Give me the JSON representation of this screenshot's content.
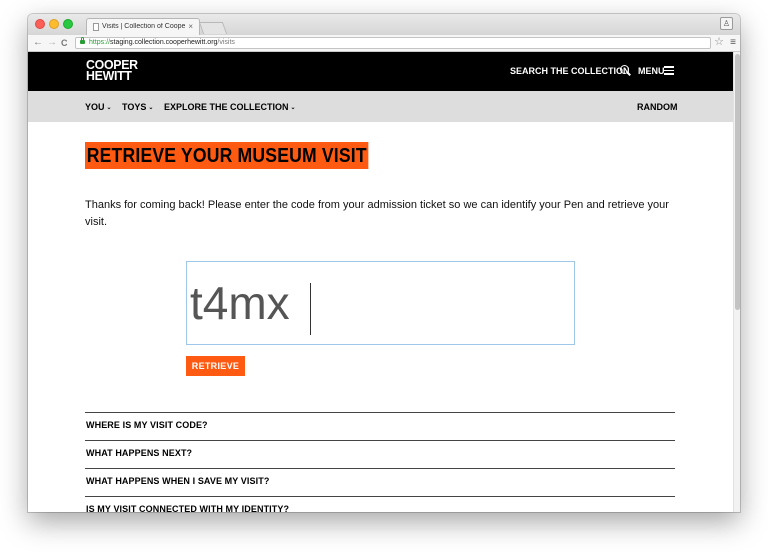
{
  "browser": {
    "tab_title": "Visits | Collection of Coope",
    "tab_close": "×",
    "url_scheme": "https://",
    "url_host": "staging.collection.cooperhewitt.org",
    "url_path": "/visits",
    "back": "←",
    "forward": "→",
    "reload": "C",
    "star": "☆",
    "menu": "≡"
  },
  "header": {
    "logo_line1": "COOPER",
    "logo_line2": "HEWITT",
    "search_label": "SEARCH THE COLLECTION",
    "menu_label": "MENU"
  },
  "subnav": {
    "items": [
      {
        "label": "YOU"
      },
      {
        "label": "TOYS"
      },
      {
        "label": "EXPLORE THE COLLECTION"
      }
    ],
    "random_label": "RANDOM",
    "caret": "⌄"
  },
  "main": {
    "title": "RETRIEVE YOUR MUSEUM VISIT",
    "intro": "Thanks for coming back! Please enter the code from your admission ticket so we can identify your Pen and retrieve your visit.",
    "code_value": "t4mx",
    "retrieve_label": "RETRIEVE"
  },
  "faq": [
    {
      "label": "WHERE IS MY VISIT CODE?"
    },
    {
      "label": "WHAT HAPPENS NEXT?"
    },
    {
      "label": "WHAT HAPPENS WHEN I SAVE MY VISIT?"
    },
    {
      "label": "IS MY VISIT CONNECTED WITH MY IDENTITY?"
    }
  ],
  "colors": {
    "accent": "#ff5a12",
    "header_bg": "#000000",
    "subnav_bg": "#dddddd"
  }
}
